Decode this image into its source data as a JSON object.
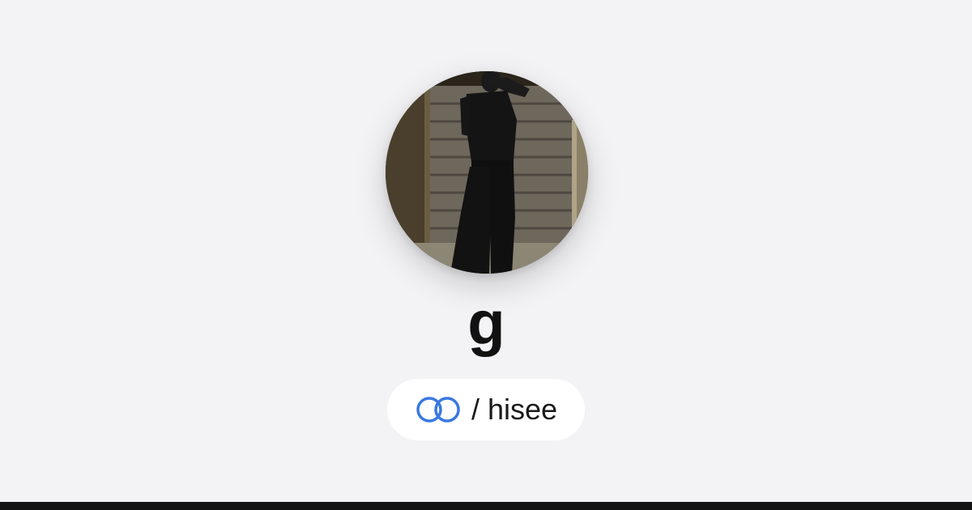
{
  "profile": {
    "display_name": "g",
    "handle_text": "/ hisee",
    "avatar_description": "profile-photo"
  },
  "brand": {
    "icon": "linked-rings-icon",
    "accent_color": "#3a78e0"
  },
  "colors": {
    "background": "#f3f3f5",
    "pill": "#ffffff",
    "text": "#111111",
    "bottom_bar": "#141414"
  }
}
